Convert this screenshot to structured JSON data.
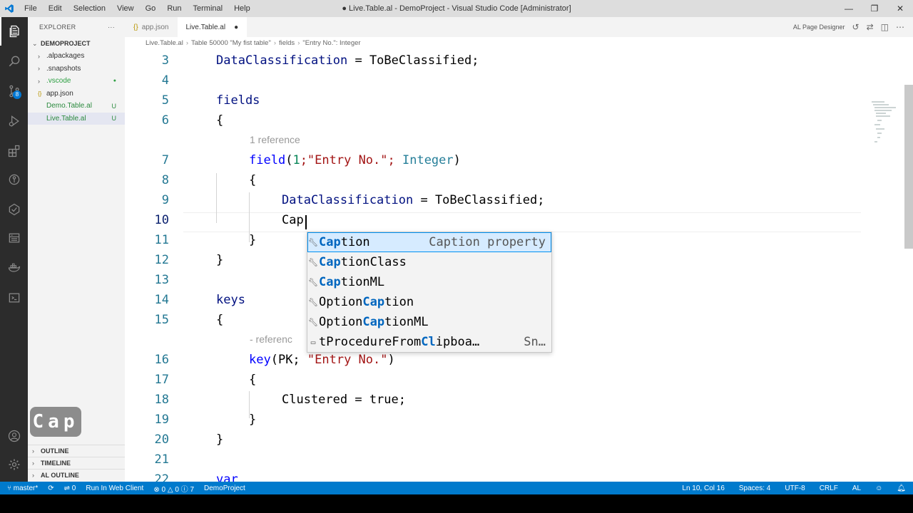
{
  "window": {
    "title": "● Live.Table.al - DemoProject - Visual Studio Code [Administrator]",
    "menu": [
      "File",
      "Edit",
      "Selection",
      "View",
      "Go",
      "Run",
      "Terminal",
      "Help"
    ],
    "controls": {
      "minimize": "—",
      "restore": "❐",
      "close": "✕"
    }
  },
  "sidebar": {
    "header": "EXPLORER",
    "more": "···",
    "project": "DEMOPROJECT",
    "items": [
      {
        "label": ".alpackages",
        "status": ""
      },
      {
        "label": ".snapshots",
        "status": ""
      },
      {
        "label": ".vscode",
        "status": "●"
      },
      {
        "label": "app.json",
        "status": ""
      },
      {
        "label": "Demo.Table.al",
        "status": "U"
      },
      {
        "label": "Live.Table.al",
        "status": "U"
      }
    ],
    "sections": [
      "OUTLINE",
      "TIMELINE",
      "AL OUTLINE"
    ],
    "key_overlay": "Cap"
  },
  "activity": {
    "scm_badge": "8"
  },
  "tabs": [
    {
      "label": "app.json",
      "icon": "{}"
    },
    {
      "label": "Live.Table.al",
      "dirty": "●"
    }
  ],
  "editor_actions": {
    "designer": "AL Page Designer"
  },
  "breadcrumb": {
    "file": "Live.Table.al",
    "table": "Table 50000 \"My fist table\"",
    "fields": "fields",
    "field": "\"Entry No.\": Integer"
  },
  "code": {
    "line_numbers": [
      "3",
      "4",
      "5",
      "6",
      "",
      "7",
      "8",
      "9",
      "10",
      "11",
      "12",
      "13",
      "14",
      "15",
      "",
      "16",
      "17",
      "18",
      "19",
      "20",
      "21",
      "22"
    ],
    "l3_prop": "DataClassification",
    "l3_rest": " = ToBeClassified;",
    "l5": "fields",
    "l6": "{",
    "ref1": "1 reference",
    "l7_kw": "field",
    "l7_a": "(",
    "l7_num": "1",
    "l7_b": ";\"Entry No.\"; ",
    "l7_type": "Integer",
    "l7_c": ")",
    "l8": "{",
    "l9_prop": "DataClassification",
    "l9_rest": " = ToBeClassified;",
    "l10": "Cap",
    "l11": "}",
    "l12": "}",
    "l14": "keys",
    "l15": "{",
    "ref2": "- referenc",
    "l16_kw": "key",
    "l16_a": "(PK; ",
    "l16_str": "\"Entry No.\"",
    "l16_b": ")",
    "l17": "{",
    "l18": "Clustered = true;",
    "l19": "}",
    "l20": "}",
    "l22": "var"
  },
  "suggest": {
    "items": [
      {
        "pre": "",
        "hl": "Cap",
        "post": "tion",
        "detail": "Caption property"
      },
      {
        "pre": "",
        "hl": "Cap",
        "post": "tionClass",
        "detail": ""
      },
      {
        "pre": "",
        "hl": "Cap",
        "post": "tionML",
        "detail": ""
      },
      {
        "pre": "Option",
        "hl": "Cap",
        "post": "tion",
        "detail": ""
      },
      {
        "pre": "Option",
        "hl": "Cap",
        "post": "tionML",
        "detail": ""
      },
      {
        "pre": "tProcedureFrom",
        "hl": "Cl",
        "post": "ipboa…",
        "detail": "Sn…"
      }
    ]
  },
  "statusbar": {
    "branch": "master*",
    "run": "Run In Web Client",
    "errors": "0",
    "warnings": "0",
    "infos": "7",
    "ports": "0",
    "project": "DemoProject",
    "position": "Ln 10, Col 16",
    "spaces": "Spaces: 4",
    "encoding": "UTF-8",
    "eol": "CRLF",
    "language": "AL"
  }
}
